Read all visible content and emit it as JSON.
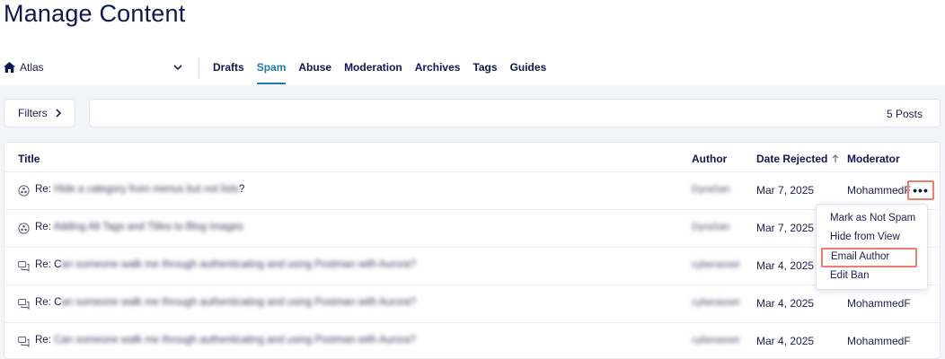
{
  "page_title": "Manage Content",
  "board": {
    "name": "Atlas"
  },
  "tabs": [
    {
      "label": "Drafts",
      "active": false
    },
    {
      "label": "Spam",
      "active": true
    },
    {
      "label": "Abuse",
      "active": false
    },
    {
      "label": "Moderation",
      "active": false
    },
    {
      "label": "Archives",
      "active": false
    },
    {
      "label": "Tags",
      "active": false
    },
    {
      "label": "Guides",
      "active": false
    }
  ],
  "filters": {
    "label": "Filters"
  },
  "post_count": "5 Posts",
  "table": {
    "headers": {
      "title": "Title",
      "author": "Author",
      "date": "Date Rejected",
      "moderator": "Moderator"
    },
    "rows": [
      {
        "prefix": "Re:",
        "title": "Hide a category from menus but not lists",
        "suffix": "?",
        "icon": "blog-icon",
        "author": "DyraSan",
        "date": "Mar 7, 2025",
        "moderator": "MohammedF"
      },
      {
        "prefix": "Re:",
        "title": "Adding Alt Tags and Titles to Blog Images",
        "suffix": "",
        "icon": "blog-icon",
        "author": "DyraSan",
        "date": "Mar 7, 2025",
        "moderator": ""
      },
      {
        "prefix": "Re: C",
        "title": "an someone walk me through authenticating and using Postman with Aurora?",
        "suffix": "",
        "icon": "forum-icon",
        "author": "cyberasset",
        "date": "Mar 4, 2025",
        "moderator": ""
      },
      {
        "prefix": "Re: C",
        "title": "an someone walk me through authenticating and using Postman with Aurora?",
        "suffix": "",
        "icon": "forum-icon",
        "author": "cyberasset",
        "date": "Mar 4, 2025",
        "moderator": "MohammedF"
      },
      {
        "prefix": "Re:",
        "title": "Can someone walk me through authenticating and using Postman with Aurora?",
        "suffix": "",
        "icon": "forum-icon",
        "author": "cyberasset",
        "date": "Mar 4, 2025",
        "moderator": "MohammedF"
      }
    ]
  },
  "row_menu": {
    "items": [
      "Mark as Not Spam",
      "Hide from View",
      "Email Author",
      "Edit Ban"
    ],
    "highlighted": "Email Author"
  },
  "colors": {
    "title": "#0f1650",
    "active_tab": "#1f7ab0",
    "highlight": "#f07c6e",
    "content_bg": "#f3f4f7"
  }
}
